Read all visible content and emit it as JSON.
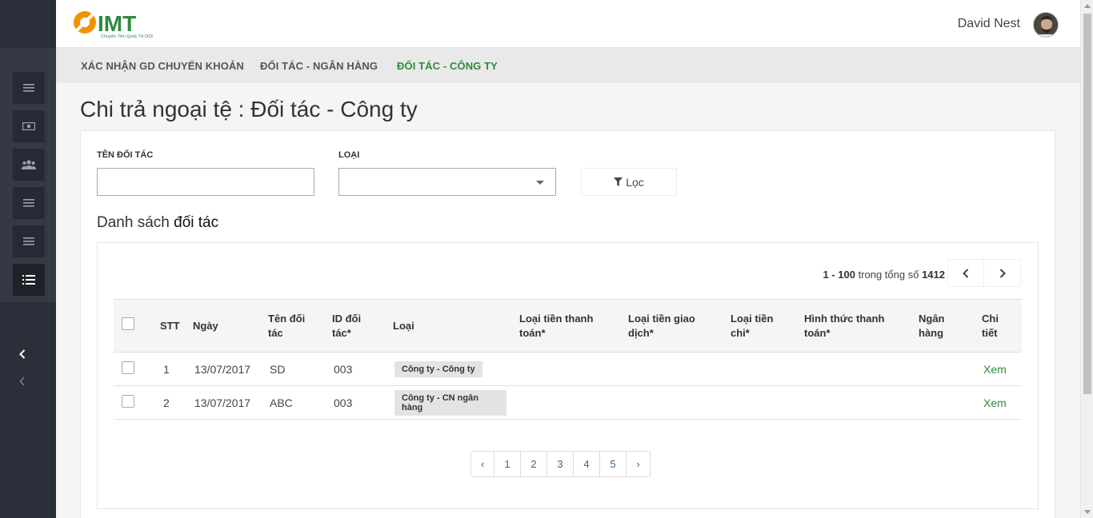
{
  "brand": {
    "name": "IMT",
    "tagline": "Chuyển Tiền Quốc Tế OCB",
    "color": "#2f8a3d",
    "accent": "#f39200"
  },
  "user": {
    "name": "David Nest"
  },
  "nav": {
    "tabs": [
      {
        "label": "XÁC NHẬN GD CHUYỂN KHOẢN",
        "active": false
      },
      {
        "label": "ĐỐI TÁC - NGÂN HÀNG",
        "active": false
      },
      {
        "label": "ĐỐI TÁC - CÔNG TY",
        "active": true
      }
    ]
  },
  "sidebar": {
    "items": [
      {
        "icon": "menu-lines-icon"
      },
      {
        "icon": "money-icon"
      },
      {
        "icon": "users-icon"
      },
      {
        "icon": "menu-lines-icon"
      },
      {
        "icon": "menu-lines-icon"
      },
      {
        "icon": "list-icon",
        "active": true
      }
    ]
  },
  "page": {
    "title": "Chi trả ngoại tệ : Đối tác - Công ty"
  },
  "filters": {
    "partner_name_label": "TÊN ĐỐI TÁC",
    "partner_name_value": "",
    "type_label": "LOẠI",
    "type_value": "",
    "filter_button": "Lọc"
  },
  "list": {
    "title_prefix": "Danh sách",
    "title_bold": "đối tác",
    "range_text": "1 - 100",
    "range_mid": "trong tổng số",
    "total": "1412"
  },
  "table": {
    "headers": {
      "stt": "STT",
      "date": "Ngày",
      "name": "Tên đối tác",
      "id": "ID đối tác*",
      "type": "Loại",
      "pay_currency": "Loại tiền thanh toán*",
      "tx_currency": "Loại tiền giao dịch*",
      "out_currency": "Loại tiền chi*",
      "pay_method": "Hình thức thanh toán*",
      "bank": "Ngân hàng",
      "detail": "Chi tiết"
    },
    "rows": [
      {
        "stt": "1",
        "date": "13/07/2017",
        "name": "SD",
        "id": "003",
        "type": "Công ty - Công ty",
        "detail": "Xem"
      },
      {
        "stt": "2",
        "date": "13/07/2017",
        "name": "ABC",
        "id": "003",
        "type": "Công ty - CN ngân hàng",
        "detail": "Xem"
      }
    ]
  },
  "pagination": {
    "prev": "‹",
    "pages": [
      "1",
      "2",
      "3",
      "4",
      "5"
    ],
    "next": "›"
  }
}
